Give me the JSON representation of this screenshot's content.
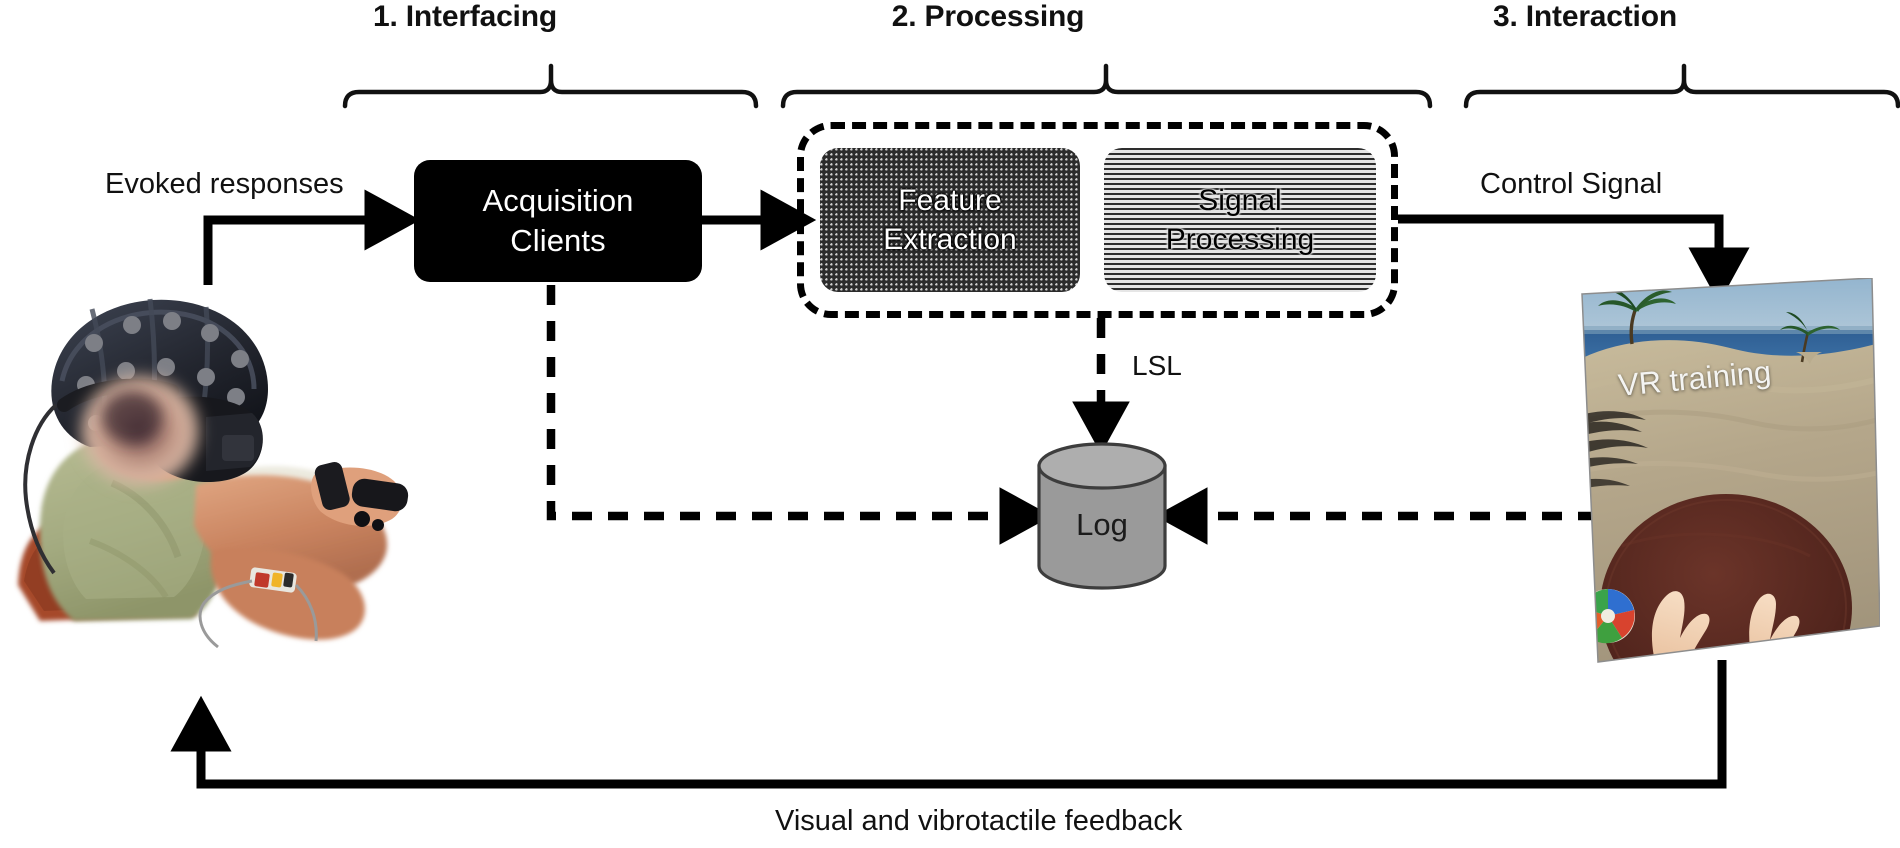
{
  "diagram": {
    "title": "BCI-VR system pipeline",
    "phases": [
      {
        "id": "interfacing",
        "label": "1. Interfacing"
      },
      {
        "id": "processing",
        "label": "2. Processing"
      },
      {
        "id": "interaction",
        "label": "3. Interaction"
      }
    ],
    "nodes": {
      "acquisition": {
        "line1": "Acquisition",
        "line2": "Clients"
      },
      "feature": {
        "line1": "Feature",
        "line2": "Extraction"
      },
      "signal": {
        "line1": "Signal",
        "line2": "Processing"
      },
      "log": {
        "label": "Log"
      }
    },
    "labels": {
      "evoked_responses": "Evoked responses",
      "control_signal": "Control Signal",
      "lsl": "LSL",
      "feedback": "Visual and vibrotactile feedback"
    },
    "vr": {
      "caption": "VR training"
    },
    "colors": {
      "ink": "#000000",
      "node_fill": "#000000",
      "node_text": "#ffffff",
      "cylinder_fill": "#9a9a9a",
      "cylinder_top": "#a8a8a8",
      "cylinder_stroke": "#3d3d3d",
      "background": "#ffffff",
      "vr_sky": "#6f9ec4",
      "vr_sea": "#2f5f96",
      "vr_sand": "#b9ab8e",
      "vr_table": "#5a2b22"
    }
  }
}
